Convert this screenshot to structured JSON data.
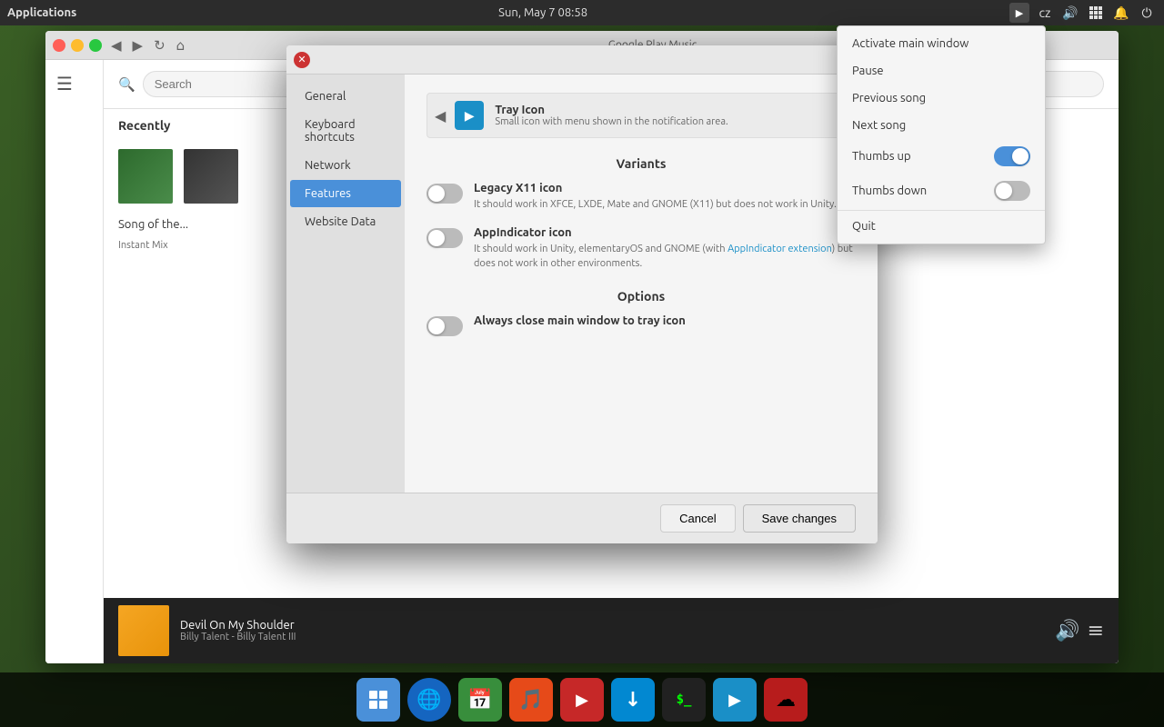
{
  "desktop": {
    "bg_color": "#2d4a1e"
  },
  "top_panel": {
    "applications_label": "Applications",
    "datetime": "Sun, May 7  08:58",
    "icons": {
      "play": "▶",
      "lang": "cz",
      "volume": "🔊",
      "network": "⊞",
      "notify": "🔔",
      "power": "⏻"
    }
  },
  "browser": {
    "title": "Google Play Music",
    "search_placeholder": "Search",
    "recently_label": "Recently",
    "nav": {
      "close": "✕",
      "back": "◀",
      "forward": "▶",
      "refresh": "↻",
      "home": "⌂"
    }
  },
  "now_playing": {
    "title": "Devil On My Shoulder",
    "artist": "Billy Talent - Billy Talent III"
  },
  "settings_dialog": {
    "sidebar": {
      "items": [
        {
          "id": "general",
          "label": "General",
          "active": false
        },
        {
          "id": "keyboard",
          "label": "Keyboard shortcuts",
          "active": false
        },
        {
          "id": "network",
          "label": "Network",
          "active": false
        },
        {
          "id": "features",
          "label": "Features",
          "active": true
        },
        {
          "id": "website",
          "label": "Website Data",
          "active": false
        }
      ]
    },
    "tray_icon": {
      "title": "Tray Icon",
      "description": "Small icon with menu shown in the notification area."
    },
    "variants_title": "Variants",
    "legacy_icon": {
      "label": "Legacy X11 icon",
      "description": "It should work in XFCE, LXDE, Mate and GNOME (X11) but does not work in Unity.",
      "enabled": false
    },
    "appindicator_icon": {
      "label": "AppIndicator icon",
      "description_pre": "It should work in Unity, elementaryOS and GNOME (with ",
      "link_text": "AppIndicator extension",
      "description_post": ") but does not work in other environments.",
      "enabled": false
    },
    "options_title": "Options",
    "close_to_tray": {
      "label": "Always close main window to tray icon",
      "enabled": false
    },
    "buttons": {
      "cancel": "Cancel",
      "save": "Save changes"
    }
  },
  "tray_menu": {
    "items": [
      {
        "id": "activate",
        "label": "Activate main window",
        "has_toggle": false
      },
      {
        "id": "pause",
        "label": "Pause",
        "has_toggle": false
      },
      {
        "id": "previous",
        "label": "Previous song",
        "has_toggle": false
      },
      {
        "id": "next",
        "label": "Next song",
        "has_toggle": false
      },
      {
        "id": "thumbsup",
        "label": "Thumbs up",
        "has_toggle": true,
        "toggle_on": true
      },
      {
        "id": "thumbsdown",
        "label": "Thumbs down",
        "has_toggle": true,
        "toggle_on": false
      },
      {
        "id": "quit",
        "label": "Quit",
        "has_toggle": false
      }
    ]
  },
  "taskbar": {
    "icons": [
      {
        "id": "multitask",
        "symbol": "⊞",
        "color": "#4a90d9",
        "bg": "#4a90d9"
      },
      {
        "id": "browser",
        "symbol": "🌐",
        "color": "#1a8fc7",
        "bg": "#1a8fc7"
      },
      {
        "id": "calendar",
        "symbol": "📅",
        "color": "#4caf50",
        "bg": "#4caf50"
      },
      {
        "id": "music",
        "symbol": "🎵",
        "color": "#ff7043",
        "bg": "#ff7043"
      },
      {
        "id": "youtube",
        "symbol": "▶",
        "color": "#f44336",
        "bg": "#f44336"
      },
      {
        "id": "download",
        "symbol": "↓",
        "color": "#29b6f6",
        "bg": "#29b6f6"
      },
      {
        "id": "terminal",
        "symbol": ">_",
        "color": "#333",
        "bg": "#333"
      },
      {
        "id": "gpmusic",
        "symbol": "▶",
        "color": "#1a8fc7",
        "bg": "#1a8fc7"
      },
      {
        "id": "cloud",
        "symbol": "☁",
        "color": "#ef5350",
        "bg": "#ef5350"
      }
    ]
  }
}
